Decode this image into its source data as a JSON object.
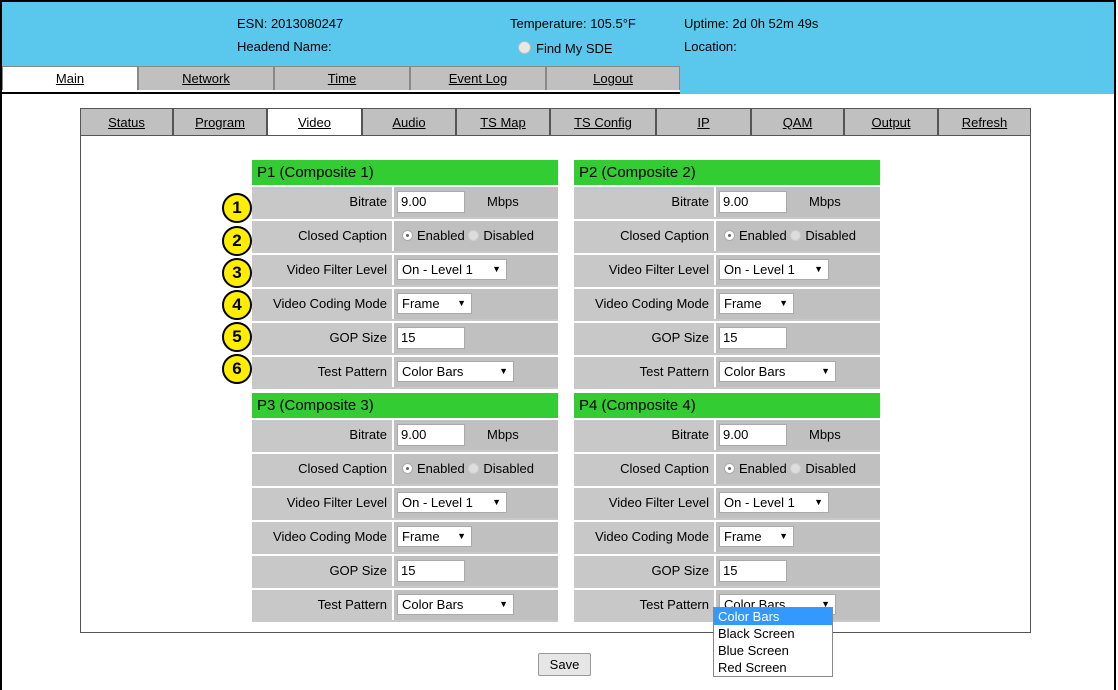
{
  "header": {
    "esn": "ESN: 2013080247",
    "headend_name": "Headend Name:",
    "temperature": "Temperature: 105.5°F",
    "find_my_sde": "Find My SDE",
    "uptime": "Uptime: 2d 0h 52m 49s",
    "location": "Location:"
  },
  "main_nav": [
    "Main",
    "Network",
    "Time",
    "Event Log",
    "Logout"
  ],
  "sub_nav": [
    "Status",
    "Program",
    "Video",
    "Audio",
    "TS Map",
    "TS Config",
    "IP",
    "QAM",
    "Output",
    "Refresh"
  ],
  "labels": {
    "bitrate": "Bitrate",
    "closed_caption": "Closed Caption",
    "video_filter_level": "Video Filter Level",
    "video_coding_mode": "Video Coding Mode",
    "gop_size": "GOP Size",
    "test_pattern": "Test Pattern",
    "mbps": "Mbps",
    "enabled": "Enabled",
    "disabled": "Disabled"
  },
  "panels": [
    {
      "title": "P1 (Composite 1)",
      "bitrate": "9.00",
      "filter": "On - Level 1",
      "coding": "Frame",
      "gop": "15",
      "pattern": "Color Bars"
    },
    {
      "title": "P2 (Composite 2)",
      "bitrate": "9.00",
      "filter": "On - Level 1",
      "coding": "Frame",
      "gop": "15",
      "pattern": "Color Bars"
    },
    {
      "title": "P3 (Composite 3)",
      "bitrate": "9.00",
      "filter": "On - Level 1",
      "coding": "Frame",
      "gop": "15",
      "pattern": "Color Bars"
    },
    {
      "title": "P4 (Composite 4)",
      "bitrate": "9.00",
      "filter": "On - Level 1",
      "coding": "Frame",
      "gop": "15",
      "pattern": "Color Bars"
    }
  ],
  "badges": [
    "1",
    "2",
    "3",
    "4",
    "5",
    "6"
  ],
  "test_pattern_options": [
    "Color Bars",
    "Black Screen",
    "Blue Screen",
    "Red Screen"
  ],
  "save_label": "Save",
  "colors": {
    "header_bg": "#5ac8ed",
    "panel_title_bg": "#33cc33",
    "badge_bg": "#ffee00",
    "highlight": "#3399ff"
  }
}
